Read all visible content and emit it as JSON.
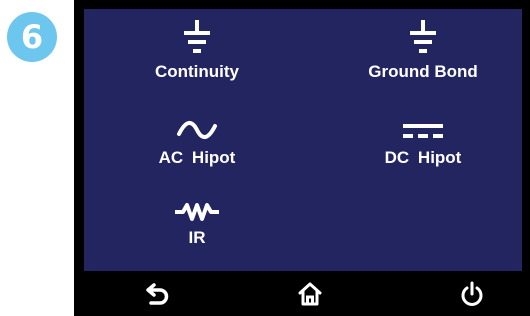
{
  "step_badge": "6",
  "menu": {
    "items": [
      {
        "label": "Continuity",
        "icon": "ground-icon"
      },
      {
        "label": "Ground Bond",
        "icon": "ground-icon"
      },
      {
        "label": "AC  Hipot",
        "icon": "ac-wave-icon"
      },
      {
        "label": "DC  Hipot",
        "icon": "dc-icon"
      },
      {
        "label": "IR",
        "icon": "resistor-icon"
      }
    ]
  },
  "navbar": {
    "back_icon": "back-arrow-icon",
    "home_icon": "home-icon",
    "power_icon": "power-icon"
  },
  "colors": {
    "panel_background": "#232561",
    "badge": "#6cc6ee",
    "text": "#ffffff",
    "bezel": "#000000"
  }
}
